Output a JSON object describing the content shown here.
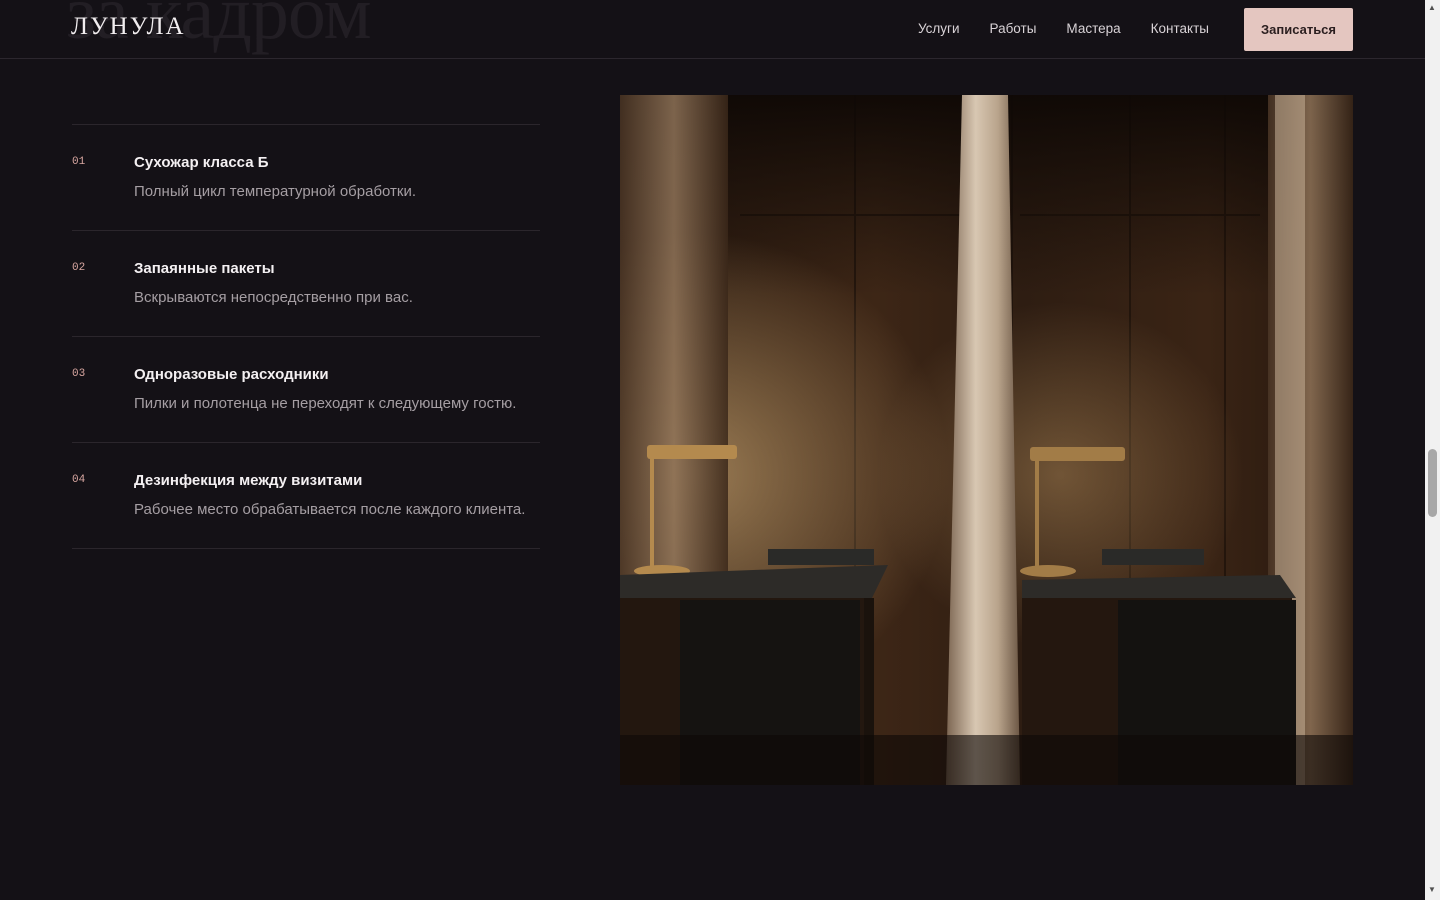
{
  "header": {
    "ghost_heading": "за кадром",
    "logo": "ЛУНУЛА",
    "nav": [
      "Услуги",
      "Работы",
      "Мастера",
      "Контакты"
    ],
    "cta_label": "Записаться"
  },
  "features": [
    {
      "num": "01",
      "title": "Сухожар класса Б",
      "desc": "Полный цикл температурной обработки."
    },
    {
      "num": "02",
      "title": "Запаянные пакеты",
      "desc": "Вскрываются непосредственно при вас."
    },
    {
      "num": "03",
      "title": "Одноразовые расходники",
      "desc": "Пилки и полотенца не переходят к следующему гостю."
    },
    {
      "num": "04",
      "title": "Дезинфекция между визитами",
      "desc": "Рабочее место обрабатывается после каждого клиента."
    }
  ],
  "colors": {
    "background": "#141116",
    "accent": "#e4c6c0",
    "number": "#d9a7a1",
    "muted_text": "#a59ea3"
  },
  "scrollbar": {
    "up_icon": "scroll-up-arrow-icon",
    "down_icon": "scroll-down-arrow-icon"
  }
}
